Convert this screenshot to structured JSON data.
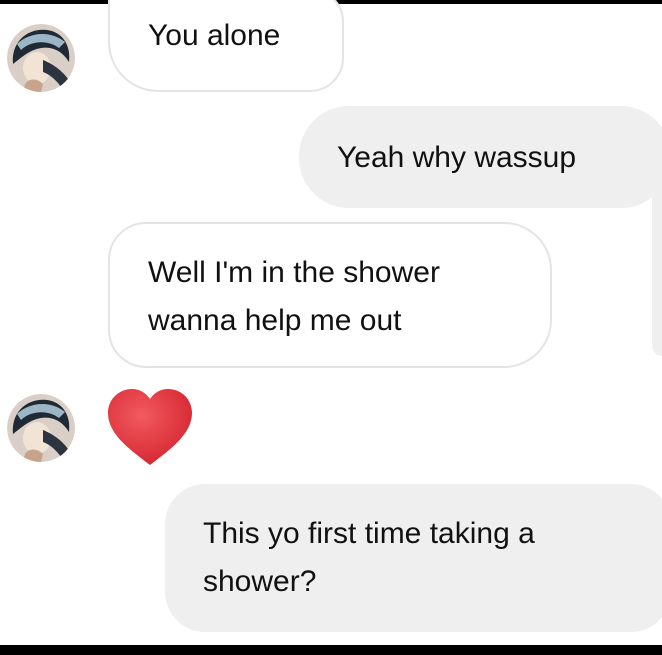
{
  "conversation": {
    "messages": [
      {
        "direction": "received",
        "lines": [
          "You alone"
        ]
      },
      {
        "direction": "sent",
        "lines": [
          "Yeah why wassup"
        ]
      },
      {
        "direction": "received",
        "lines": [
          "Well I'm in the shower",
          "wanna help me out"
        ]
      },
      {
        "direction": "received",
        "reaction": "heart-icon"
      },
      {
        "direction": "sent",
        "lines": [
          "This yo first time taking a",
          "shower?"
        ]
      }
    ]
  },
  "colors": {
    "received_bubble_border": "#e4e4e4",
    "sent_bubble_background": "#efefef",
    "heart": "#e8333d",
    "text": "#111111"
  }
}
